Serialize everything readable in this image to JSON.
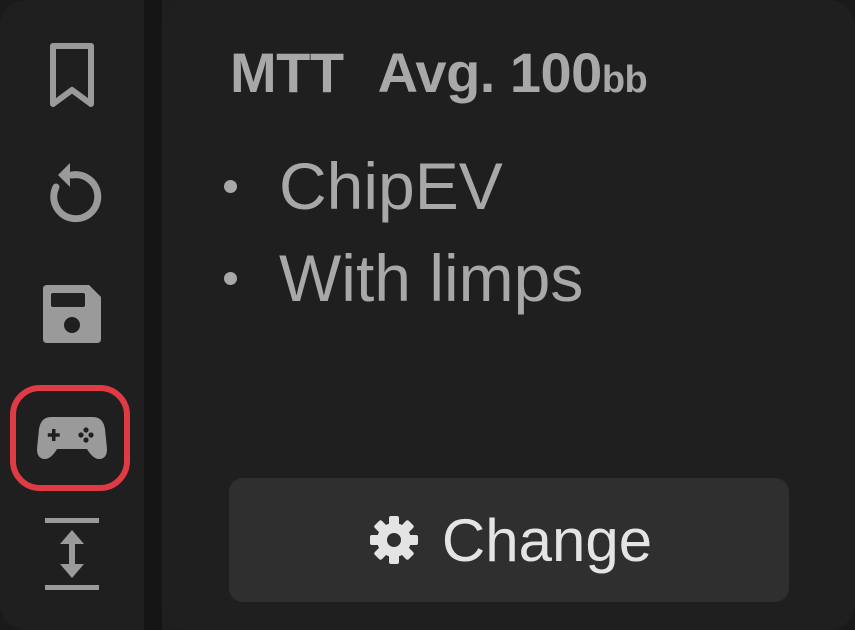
{
  "sidebar": {
    "items": [
      {
        "icon": "bookmark-icon"
      },
      {
        "icon": "reset-icon"
      },
      {
        "icon": "save-icon"
      },
      {
        "icon": "gamepad-icon",
        "highlighted": true
      },
      {
        "icon": "expand-vertical-icon"
      }
    ]
  },
  "panel": {
    "title": {
      "format": "MTT",
      "stack_label": "Avg. 100",
      "stack_unit": "bb"
    },
    "bullets": [
      "ChipEV",
      "With limps"
    ],
    "change_button": {
      "label": "Change",
      "icon": "gear-icon"
    }
  },
  "colors": {
    "background": "#1f1f1f",
    "text_muted": "#a8a8a8",
    "button_bg": "#2f2f2f",
    "button_text": "#e4e4e4",
    "highlight": "#e03a44"
  }
}
